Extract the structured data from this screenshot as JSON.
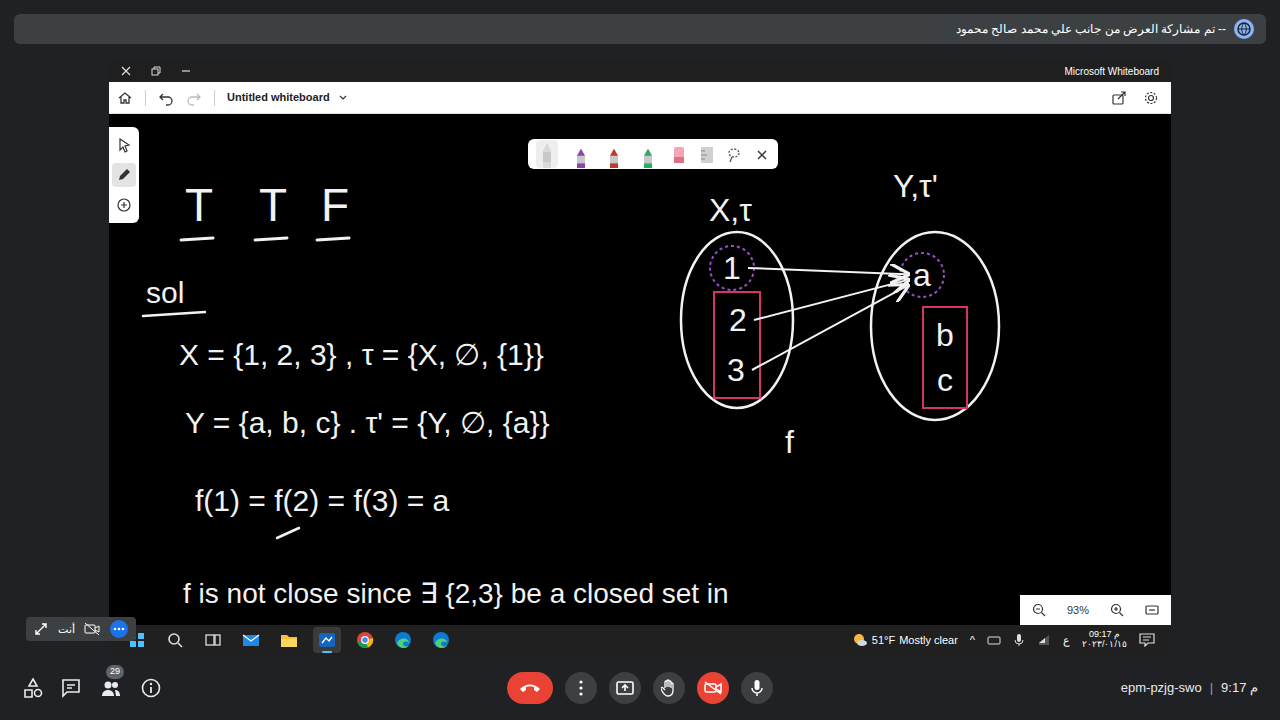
{
  "meet": {
    "banner": "تم مشاركة العرض من جانب علي محمد صالح محمود --",
    "participants_count": "29",
    "self_label": "أنت",
    "meeting_code": "epm-pzjg-swo",
    "separator": "|",
    "time": "9:17 م",
    "camera_on": false,
    "mic_on": true
  },
  "whiteboard": {
    "app_title": "Microsoft Whiteboard",
    "board_name": "Untitled whiteboard",
    "zoom": "93%",
    "tools": [
      {
        "kind": "select",
        "selected": false
      },
      {
        "kind": "pen",
        "selected": true
      },
      {
        "kind": "add",
        "selected": false
      }
    ],
    "pens": [
      {
        "color": "#d9d9d9",
        "selected": true
      },
      {
        "color": "#8e44ad",
        "selected": false
      },
      {
        "color": "#c0392b",
        "selected": false
      },
      {
        "color": "#27ae60",
        "selected": false
      }
    ]
  },
  "canvas": {
    "answers": [
      "T",
      "T",
      "F"
    ],
    "heading": "sol",
    "lines": [
      "X = {1, 2, 3} , τ = {X, ∅, {1}}",
      "Y = {a, b, c} . τ' = {Y, ∅, {a}}",
      "f(1) = f(2) = f(3) = a",
      "f is not close since ∃ {2,3} be a closed set in"
    ],
    "diagram": {
      "map_label": "f",
      "groups": [
        {
          "kind": "open",
          "color": "#9b4dca"
        },
        {
          "kind": "closed",
          "color": "#d6336c"
        }
      ],
      "domain": {
        "label": "X,τ",
        "points": [
          {
            "label": "1",
            "kind": "open"
          },
          {
            "label": "2",
            "kind": "closed"
          },
          {
            "label": "3",
            "kind": "closed"
          }
        ]
      },
      "codomain": {
        "label": "Y,τ'",
        "points": [
          {
            "label": "a",
            "kind": "open"
          },
          {
            "label": "b",
            "kind": "closed"
          },
          {
            "label": "c",
            "kind": "closed"
          }
        ]
      },
      "arrows": [
        {
          "from": "1",
          "to": "a"
        },
        {
          "from": "2",
          "to": "a"
        },
        {
          "from": "3",
          "to": "a"
        }
      ]
    }
  },
  "taskbar": {
    "apps": [
      {
        "kind": "start",
        "active": false
      },
      {
        "kind": "search",
        "active": false
      },
      {
        "kind": "taskview",
        "active": false
      },
      {
        "kind": "mail",
        "active": false
      },
      {
        "kind": "explorer",
        "active": false
      },
      {
        "kind": "whiteboard",
        "active": true
      },
      {
        "kind": "chrome",
        "active": false
      },
      {
        "kind": "edge",
        "active": false
      },
      {
        "kind": "edge",
        "active": false
      }
    ],
    "weather_temp": "51°F",
    "weather_text": "Mostly clear",
    "chevron": "^",
    "lang": "ع",
    "clock_time": "09:17 م",
    "clock_date": "٢٠٢٣/٠١/١٥"
  }
}
